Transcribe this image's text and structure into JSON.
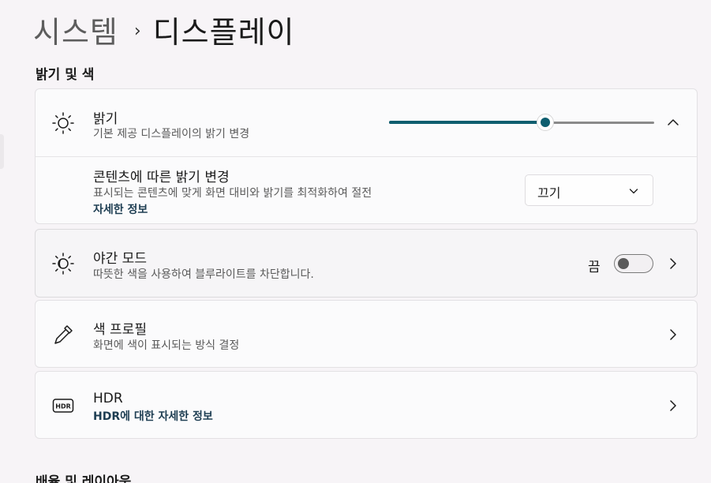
{
  "breadcrumb": {
    "parent": "시스템",
    "separator": "›",
    "current": "디스플레이"
  },
  "sections": {
    "brightness_color": "밝기 및 색",
    "scale_layout": "배율 및 레이아웃"
  },
  "brightness": {
    "title": "밝기",
    "subtitle": "기본 제공 디스플레이의 밝기 변경",
    "slider_value_percent": 59,
    "icon": "sun-icon",
    "expanded": true
  },
  "content_adaptive": {
    "title": "콘텐츠에 따른 밝기 변경",
    "subtitle": "표시되는 콘텐츠에 맞게 화면 대비와 밝기를 최적화하여 절전",
    "link": "자세한 정보",
    "dropdown_value": "끄기"
  },
  "night_light": {
    "title": "야간 모드",
    "subtitle": "따뜻한 색을 사용하여 블루라이트를 차단합니다.",
    "toggle_label": "끔",
    "toggle_on": false,
    "icon": "night-light-icon"
  },
  "color_profile": {
    "title": "색 프로필",
    "subtitle": "화면에 색이 표시되는 방식 결정",
    "icon": "eyedropper-icon"
  },
  "hdr": {
    "title": "HDR",
    "link": "HDR에 대한 자세한 정보",
    "icon": "hdr-icon",
    "icon_text": "HDR"
  },
  "colors": {
    "accent": "#0e5e6f",
    "background": "#f7f4f7",
    "card": "#fbfbfc"
  }
}
